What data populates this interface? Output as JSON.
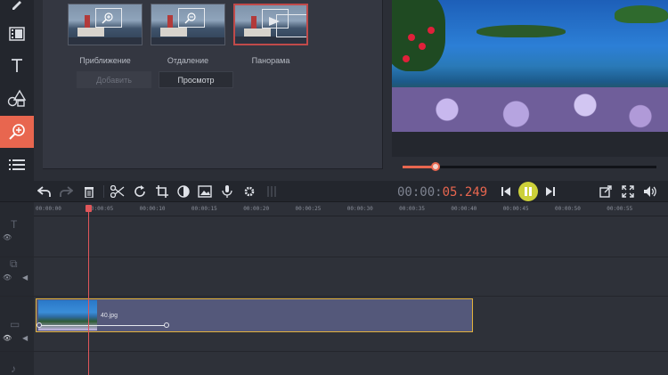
{
  "sidebar": {
    "tools": [
      {
        "icon": "pen-icon"
      },
      {
        "icon": "film-icon"
      },
      {
        "icon": "text-icon",
        "glyph": "T"
      },
      {
        "icon": "shapes-icon"
      },
      {
        "icon": "zoom-icon"
      },
      {
        "icon": "list-icon"
      }
    ],
    "active_tool": "zoom-icon"
  },
  "effects": [
    {
      "label": "Приближение"
    },
    {
      "label": "Отдаление"
    },
    {
      "label": "Панорама"
    }
  ],
  "buttons": {
    "add": "Добавить",
    "preview": "Просмотр"
  },
  "playback": {
    "progress": 0.13,
    "timecode_dim": "00:00:",
    "timecode_red": "05.249"
  },
  "toolbar": {
    "icons": [
      "undo-icon",
      "redo-icon",
      "trash-icon",
      "cut-icon",
      "rotate-icon",
      "crop-icon",
      "color-icon",
      "image-icon",
      "mic-icon",
      "settings-icon",
      "grip-icon"
    ],
    "player_icons": [
      "prev-icon",
      "pause-icon",
      "next-icon"
    ],
    "right_icons": [
      "export-icon",
      "fullscreen-icon",
      "volume-icon"
    ]
  },
  "ruler": {
    "labels": [
      "00:00:00",
      "00:00:05",
      "00:00:10",
      "00:00:15",
      "00:00:20",
      "00:00:25",
      "00:00:30",
      "00:00:35",
      "00:00:40",
      "00:00:45",
      "00:00:50",
      "00:00:55"
    ]
  },
  "clip": {
    "name": "40.jpg"
  },
  "colors": {
    "accent": "#e8664f",
    "clip_border": "#e3b23c",
    "highlight": "#eaee3c"
  }
}
